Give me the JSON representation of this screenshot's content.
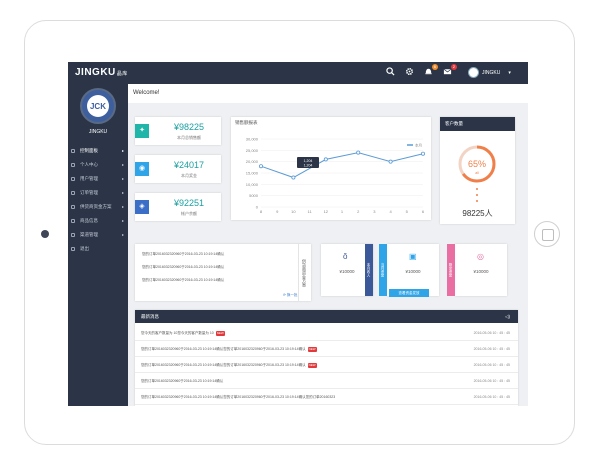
{
  "topbar": {
    "logo": "JINGKU",
    "logo_sub": "晶库",
    "user_name": "JINGKU",
    "notif_count": "6",
    "mail_count": "2"
  },
  "sidebar": {
    "name": "JINGKU",
    "items": [
      {
        "label": "控制面板",
        "active": true
      },
      {
        "label": "个人中心"
      },
      {
        "label": "用户管理"
      },
      {
        "label": "订单管理"
      },
      {
        "label": "供货商资金方案"
      },
      {
        "label": "商品信息"
      },
      {
        "label": "渠道管理"
      },
      {
        "label": "退出"
      }
    ]
  },
  "welcome": "Welcome!",
  "stats": [
    {
      "value": "¥98225",
      "label": "本月总销售额",
      "color": "#1fb5a8",
      "icon": "bulb-icon"
    },
    {
      "value": "¥24017",
      "label": "本月奖金",
      "color": "#2fa4e7",
      "icon": "drop-icon"
    },
    {
      "value": "¥92251",
      "label": "帐户余额",
      "color": "#3b6fc7",
      "icon": "shield-icon"
    }
  ],
  "chart": {
    "title": "销售额报表",
    "legend": "本月"
  },
  "chart_data": {
    "type": "line",
    "title": "销售额报表",
    "categories": [
      "8",
      "9",
      "10",
      "11",
      "12",
      "1",
      "2",
      "3",
      "4",
      "5",
      "6"
    ],
    "series": [
      {
        "name": "本月",
        "values": [
          18000,
          null,
          13000,
          null,
          21000,
          null,
          24000,
          null,
          20000,
          null,
          23500
        ]
      }
    ],
    "ylim": [
      0,
      30000
    ],
    "yticks": [
      "30,000",
      "25,000",
      "20,000",
      "15,000",
      "10,000",
      "5000",
      "0"
    ],
    "tooltip": {
      "label": "1,204",
      "value": "1,204"
    },
    "color": "#5b9bd5"
  },
  "donut": {
    "title": "客户数量",
    "percent": "65%",
    "percent_value": 65,
    "sublabel": "all",
    "total": "98225人",
    "color": "#f0804a"
  },
  "list_card": {
    "rows": [
      "您的订单2016032320960于2016-03-23 10:19:14确认",
      "您的订单2016032320960于2016-03-23 10:19:14确认",
      "您的订单2016032320960于2016-03-23 10:19:14确认"
    ],
    "side": "供货商资金方案",
    "more": "换一批"
  },
  "minis": [
    {
      "value": "¥10000",
      "ribbon": "本月收入",
      "color": "#3b5998",
      "icon": "medal-icon"
    },
    {
      "value": "¥10000",
      "ribbon": "当月资金",
      "color": "#2fa4e7",
      "icon": "clipboard-icon",
      "button": "查看资金发放"
    },
    {
      "value": "¥10000",
      "ribbon": "剩余资金",
      "color": "#e96fa3",
      "icon": "target-icon"
    }
  ],
  "news": {
    "title": "最新消息",
    "rows": [
      {
        "text": "您今天的客户数量为  10您今天的客户数量为  10",
        "tag": "NEW",
        "time": "2016-05-06  10 : 45 : 45"
      },
      {
        "text": "您的订单2016032320960于2016-03-23 10:19:14确认您的订单2016032320960于2016-03-23 10:19:14确认",
        "tag": "NEW",
        "time": "2016-05-06  10 : 45 : 45"
      },
      {
        "text": "您的订单2016032320960于2016-03-23 10:19:14确认您的订单2016032320960于2016-03-23 10:19:14确认",
        "tag": "NEW",
        "time": "2016-05-06  10 : 45 : 45"
      },
      {
        "text": "您的订单2016032320960于2016-03-23 10:19:14确认",
        "tag": "",
        "time": "2016-05-06  10 : 45 : 45"
      },
      {
        "text": "您的订单2016032320960于2016-03-23 10:19:14确认您的订单2016032320960于2016-03-23 10:19:14确认您的订单20160323",
        "tag": "",
        "time": "2016-05-06  10 : 45 : 45"
      }
    ]
  }
}
